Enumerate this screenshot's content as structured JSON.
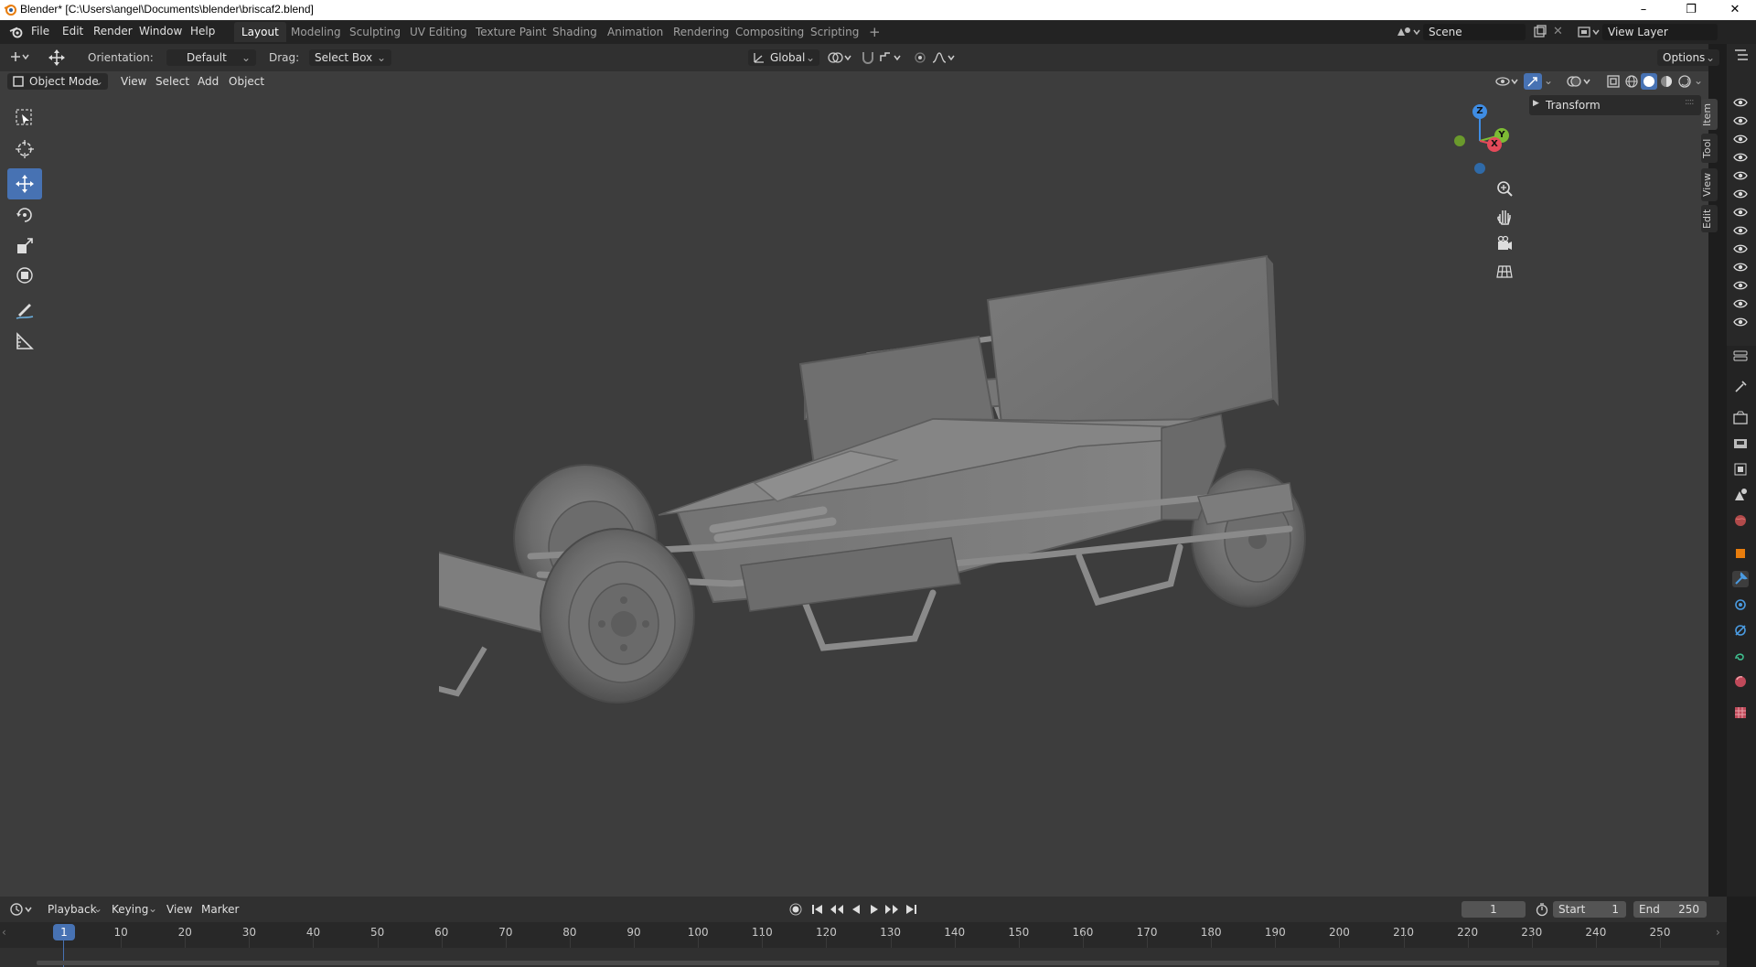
{
  "window": {
    "title": "Blender* [C:\\Users\\angel\\Documents\\blender\\briscaf2.blend]"
  },
  "topbar": {
    "menus": [
      "File",
      "Edit",
      "Render",
      "Window",
      "Help"
    ],
    "workspaces": [
      "Layout",
      "Modeling",
      "Sculpting",
      "UV Editing",
      "Texture Paint",
      "Shading",
      "Animation",
      "Rendering",
      "Compositing",
      "Scripting"
    ],
    "active_workspace": "Layout",
    "add_tab": "+",
    "scene": "Scene",
    "view_layer": "View Layer"
  },
  "tool_header": {
    "orientation_label": "Orientation:",
    "orientation_value": "Default",
    "drag_label": "Drag:",
    "drag_value": "Select Box",
    "transform_orientation": "Global",
    "options": "Options"
  },
  "viewport_header": {
    "mode": "Object Mode",
    "menus": [
      "View",
      "Select",
      "Add",
      "Object"
    ]
  },
  "sidebar": {
    "panel": "Transform",
    "tabs": [
      "Item",
      "Tool",
      "View",
      "Edit"
    ]
  },
  "gizmo": {
    "z": "Z",
    "y": "Y",
    "x": "X"
  },
  "timeline": {
    "menus": [
      "Playback",
      "Keying",
      "View",
      "Marker"
    ],
    "current_frame": "1",
    "start_label": "Start",
    "start_value": "1",
    "end_label": "End",
    "end_value": "250",
    "ruler": [
      "1",
      "10",
      "20",
      "30",
      "40",
      "50",
      "60",
      "70",
      "80",
      "90",
      "100",
      "110",
      "120",
      "130",
      "140",
      "150",
      "160",
      "170",
      "180",
      "190",
      "200",
      "210",
      "220",
      "230",
      "240",
      "250"
    ]
  },
  "colors": {
    "accent": "#4772b3",
    "viewport_bg": "#3d3d3d",
    "axis_x": "#e44a5a",
    "axis_y": "#7dbb34",
    "axis_z": "#3f8de4"
  }
}
